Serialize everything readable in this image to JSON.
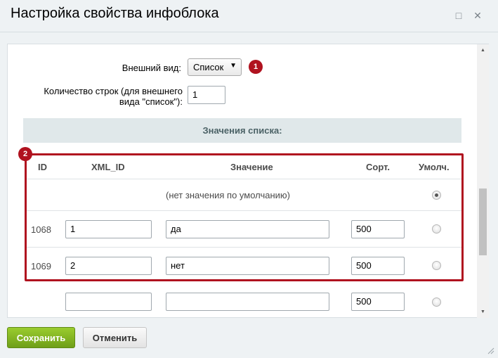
{
  "dialog": {
    "title": "Настройка свойства инфоблока",
    "icons": {
      "maximize": "maximize-icon",
      "close": "close-icon"
    }
  },
  "form": {
    "view_label": "Внешний вид:",
    "view_value": "Список",
    "rows_label_line1": "Количество строк (для внешнего",
    "rows_label_line2": "вида \"список\"):",
    "rows_value": "1",
    "badge1": "1",
    "badge2": "2"
  },
  "list_values": {
    "section_title": "Значения списка:",
    "columns": {
      "id": "ID",
      "xml_id": "XML_ID",
      "value": "Значение",
      "sort": "Сорт.",
      "default": "Умолч."
    },
    "no_default_text": "(нет значения по умолчанию)",
    "rows": [
      {
        "id": "1068",
        "xml_id": "1",
        "value": "да",
        "sort": "500",
        "default": false
      },
      {
        "id": "1069",
        "xml_id": "2",
        "value": "нет",
        "sort": "500",
        "default": false
      },
      {
        "id": "",
        "xml_id": "",
        "value": "",
        "sort": "500",
        "default": false
      }
    ]
  },
  "buttons": {
    "save": "Сохранить",
    "cancel": "Отменить"
  },
  "colors": {
    "accent_red": "#b0121f",
    "save_green": "#7fb121",
    "section_bg": "#e0e8ea"
  }
}
